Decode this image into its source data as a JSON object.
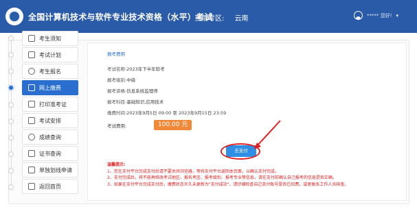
{
  "header": {
    "title": "全国计算机技术与软件专业技术资格（水平）考试",
    "area_label": "当前考区:",
    "area_value": "云南",
    "user_name": "*****  您好!",
    "caret": "▾"
  },
  "sidebar": {
    "items": [
      {
        "label": "考生须知"
      },
      {
        "label": "考试计划"
      },
      {
        "label": "考生报名"
      },
      {
        "label": "网上缴费",
        "active": true
      },
      {
        "label": "打印准考证"
      },
      {
        "label": "考试安排"
      },
      {
        "label": "成绩查询"
      },
      {
        "label": "证书查询"
      },
      {
        "label": "单独划线申请"
      },
      {
        "label": "返回首页"
      }
    ]
  },
  "main": {
    "section_title": "报考费用",
    "fields": [
      {
        "label": "考试名称:",
        "value": "2023年下半年软考"
      },
      {
        "label": "报考级别:",
        "value": "中级"
      },
      {
        "label": "报考资格:",
        "value": "信息系统监理师"
      },
      {
        "label": "报考科目:",
        "value": "基础知识,应用技术"
      },
      {
        "label": "缴费时间:",
        "value": "2023年9月5日 09:00 至 2023年9月15日 23:59"
      }
    ],
    "fee_label": "考试费用:",
    "fee_value": "100.00 元",
    "pay_button": "去支付",
    "tips_title": "温馨提示:",
    "tips": [
      "1、您在支付平台完成支付后请不要关闭浏览器，等待支付平台返回本页面，以确认支付完成。",
      "2、支付完成后，将不能再修改考试地区、报名考区、报考级别、报考专业等信息，请在支付前确认自己报考的信息是否正确。",
      "3、如果在支付平台完成支付后，缴费状态许久未更新为\"支付成功\"，请仔细检查自己支付账号是否已扣费，或者联系工作人员核查。"
    ]
  },
  "colors": {
    "header_bg": "#2a5ba8",
    "active_nav": "#2a6fd0",
    "fee_badge": "#f08a3a",
    "pay_button": "#2f8fe6",
    "warning": "#e02020"
  }
}
